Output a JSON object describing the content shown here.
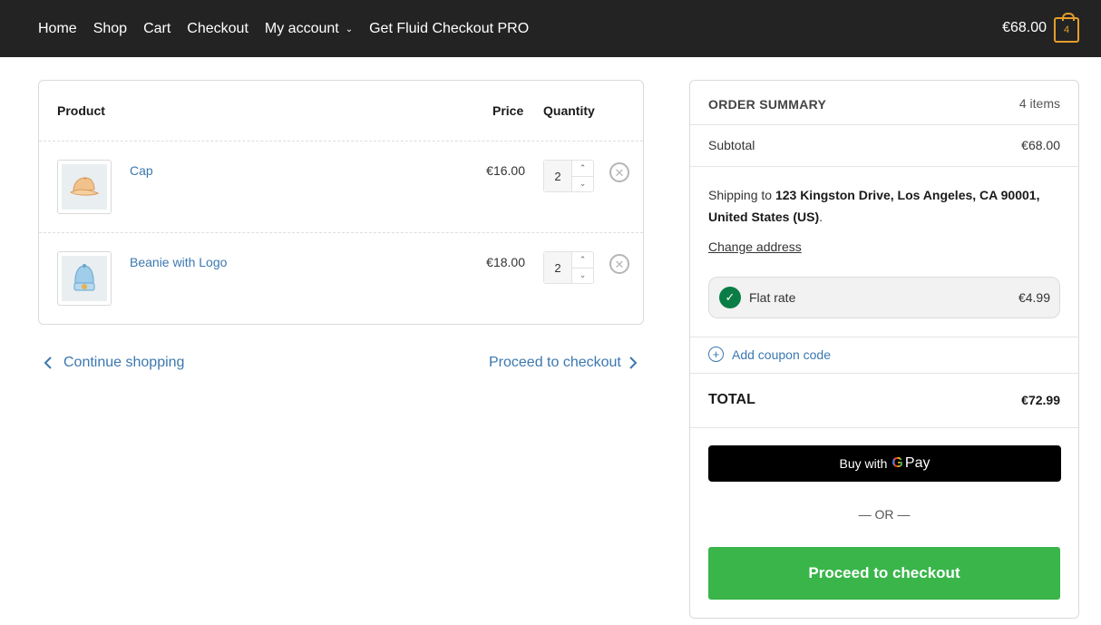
{
  "header": {
    "nav": [
      {
        "label": "Home"
      },
      {
        "label": "Shop"
      },
      {
        "label": "Cart"
      },
      {
        "label": "Checkout"
      },
      {
        "label": "My account",
        "has_dropdown": true
      },
      {
        "label": "Get Fluid Checkout PRO"
      }
    ],
    "cart_total": "€68.00",
    "cart_count": "4",
    "colors": {
      "background": "#232323",
      "accent": "#e49e2b"
    }
  },
  "cart": {
    "columns": {
      "product": "Product",
      "price": "Price",
      "quantity": "Quantity"
    },
    "items": [
      {
        "name": "Cap",
        "price": "€16.00",
        "quantity": "2",
        "icon": "cap-icon"
      },
      {
        "name": "Beanie with Logo",
        "price": "€18.00",
        "quantity": "2",
        "icon": "beanie-icon"
      }
    ],
    "continue_label": "Continue shopping",
    "proceed_label": "Proceed to checkout"
  },
  "summary": {
    "title": "ORDER SUMMARY",
    "items_count": "4 items",
    "subtotal_label": "Subtotal",
    "subtotal_value": "€68.00",
    "shipping_prefix": "Shipping to",
    "shipping_address": "123 Kingston Drive, Los Angeles, CA 90001, United States (US)",
    "shipping_suffix": ".",
    "change_address": "Change address",
    "rate_label": "Flat rate",
    "rate_value": "€4.99",
    "coupon_label": "Add coupon code",
    "total_label": "TOTAL",
    "total_value": "€72.99",
    "gpay_prefix": "Buy with",
    "gpay_g": "G",
    "gpay_pay": "Pay",
    "or_label": "— OR —",
    "checkout_button": "Proceed to checkout",
    "colors": {
      "checkout": "#39b54a",
      "link": "#3b78b0",
      "check": "#0a7d46"
    }
  }
}
